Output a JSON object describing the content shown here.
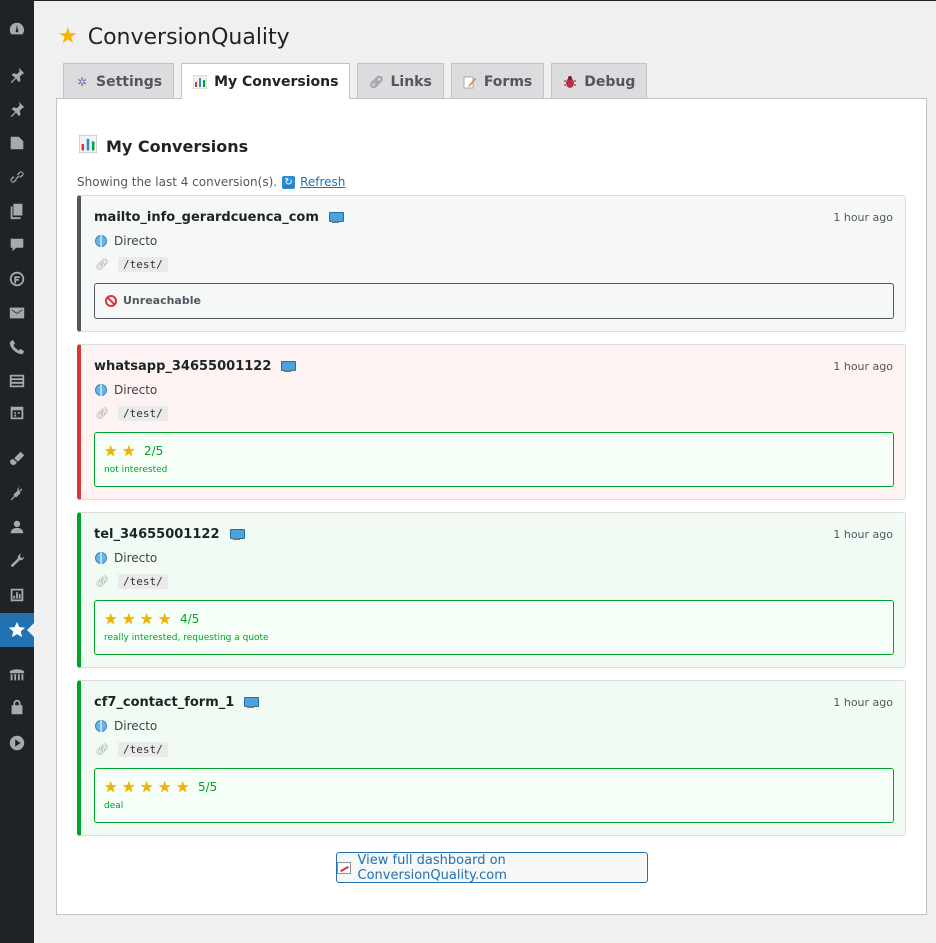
{
  "page": {
    "title": "ConversionQuality"
  },
  "tabs": [
    {
      "label": "Settings",
      "icon": "gear-icon"
    },
    {
      "label": "My Conversions",
      "icon": "bar-chart-icon"
    },
    {
      "label": "Links",
      "icon": "link-icon"
    },
    {
      "label": "Forms",
      "icon": "form-icon"
    },
    {
      "label": "Debug",
      "icon": "bug-icon"
    }
  ],
  "panel": {
    "title": "My Conversions",
    "showing_text": "Showing the last 4 conversion(s).",
    "refresh_label": "Refresh"
  },
  "conversions": [
    {
      "name": "mailto_info_gerardcuenca_com",
      "time": "1 hour ago",
      "source": "Directo",
      "path": "/test/",
      "status": "Unreachable"
    },
    {
      "name": "whatsapp_34655001122",
      "time": "1 hour ago",
      "source": "Directo",
      "path": "/test/",
      "rating": 2,
      "score": "2/5",
      "note": "not interested"
    },
    {
      "name": "tel_34655001122",
      "time": "1 hour ago",
      "source": "Directo",
      "path": "/test/",
      "rating": 4,
      "score": "4/5",
      "note": "really interested, requesting a quote"
    },
    {
      "name": "cf7_contact_form_1",
      "time": "1 hour ago",
      "source": "Directo",
      "path": "/test/",
      "rating": 5,
      "score": "5/5",
      "note": "deal"
    }
  ],
  "dashboard_button": "View full dashboard on ConversionQuality.com",
  "colors": {
    "accent": "#2271b1",
    "positive": "#00a32a",
    "negative": "#d63638",
    "neutral": "#50575e",
    "star": "#f0b400"
  }
}
